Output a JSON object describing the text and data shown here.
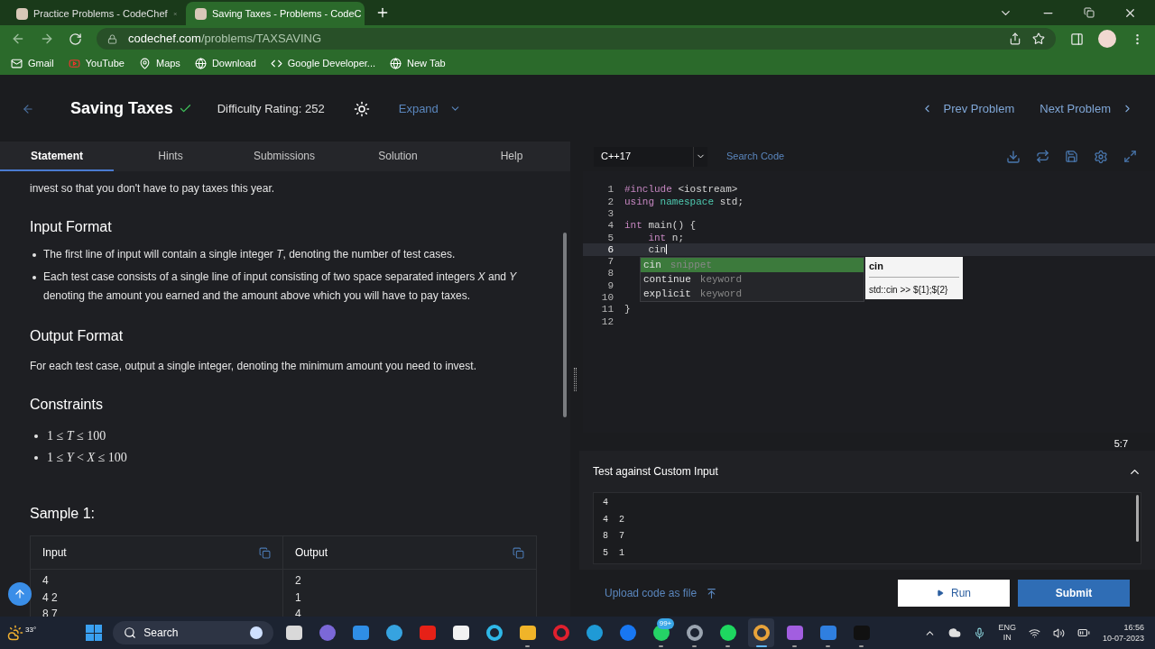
{
  "browser": {
    "tabs": [
      {
        "title": "Practice Problems - CodeChef",
        "selected": false
      },
      {
        "title": "Saving Taxes - Problems - CodeC",
        "selected": true
      }
    ],
    "url_host": "codechef.com",
    "url_path": "/problems/TAXSAVING",
    "bookmarks": [
      {
        "label": "Gmail",
        "kind": "mail"
      },
      {
        "label": "YouTube",
        "kind": "video"
      },
      {
        "label": "Maps",
        "kind": "pin"
      },
      {
        "label": "Download",
        "kind": "globe"
      },
      {
        "label": "Google Developer...",
        "kind": "code"
      },
      {
        "label": "New Tab",
        "kind": "globe"
      }
    ]
  },
  "problem": {
    "title": "Saving Taxes",
    "solved": true,
    "difficulty": "Difficulty Rating: 252",
    "expand": "Expand",
    "prev": "Prev Problem",
    "next": "Next Problem"
  },
  "statement_tabs": [
    {
      "label": "Statement",
      "selected": true
    },
    {
      "label": "Hints",
      "selected": false
    },
    {
      "label": "Submissions",
      "selected": false
    },
    {
      "label": "Solution",
      "selected": false
    },
    {
      "label": "Help",
      "selected": false
    }
  ],
  "statement": {
    "intro": "invest so that you don't have to pay taxes this year.",
    "sections": [
      {
        "kind": "bullets",
        "heading": "Input Format",
        "items": [
          "The first line of input will contain a single integer *T*, denoting the number of test cases.",
          "Each test case consists of a single line of input consisting of two space separated integers *X* and *Y* denoting the amount you earned and the amount above which you will have to pay taxes."
        ]
      },
      {
        "kind": "paragraph",
        "heading": "Output Format",
        "text": "For each test case, output a single integer, denoting the minimum amount you need to invest."
      },
      {
        "kind": "math",
        "heading": "Constraints",
        "items": [
          "1 ≤ *T* ≤ 100",
          "1 ≤ *Y* < *X* ≤ 100"
        ]
      }
    ]
  },
  "sample": {
    "heading": "Sample 1:",
    "input_label": "Input",
    "output_label": "Output",
    "input_lines": [
      "4",
      "4 2",
      "8 7"
    ],
    "output_lines": [
      "2",
      "1",
      "4"
    ]
  },
  "editor": {
    "language": "C++17",
    "search_placeholder": "Search Code",
    "cursor": "5:7",
    "lines": [
      {
        "number": "1",
        "active": false,
        "tokens": [
          {
            "text": "#include",
            "kind": "keyword"
          },
          {
            "text": " <iostream>",
            "kind": "plain"
          }
        ]
      },
      {
        "number": "2",
        "active": false,
        "tokens": [
          {
            "text": "using",
            "kind": "keyword"
          },
          {
            "text": " namespace",
            "kind": "namespace"
          },
          {
            "text": " std;",
            "kind": "plain"
          }
        ]
      },
      {
        "number": "3",
        "active": false
      },
      {
        "number": "4",
        "active": false,
        "tokens": [
          {
            "text": "int",
            "kind": "keyword"
          },
          {
            "text": " main() {",
            "kind": "plain"
          }
        ]
      },
      {
        "number": "5",
        "active": false,
        "tokens": [
          {
            "text": "    int",
            "kind": "keyword"
          },
          {
            "text": " n;",
            "kind": "plain"
          }
        ]
      },
      {
        "number": "6",
        "active": true,
        "tokens": [
          {
            "text": "    cin",
            "kind": "plain"
          }
        ]
      },
      {
        "number": "7",
        "active": false
      },
      {
        "number": "8",
        "active": false
      },
      {
        "number": "9",
        "active": false
      },
      {
        "number": "10",
        "active": false
      },
      {
        "number": "11",
        "active": false,
        "tokens": [
          {
            "text": "}",
            "kind": "plain"
          }
        ]
      },
      {
        "number": "12",
        "active": false
      }
    ],
    "suggestions": [
      {
        "label": "cin",
        "detail": "snippet",
        "selected": true
      },
      {
        "label": "continue",
        "detail": "keyword",
        "selected": false
      },
      {
        "label": "explicit",
        "detail": "keyword",
        "selected": false
      }
    ],
    "doc": {
      "title": "cin",
      "detail": "std::cin >> ${1};${2}"
    }
  },
  "custom_input": {
    "title": "Test against Custom Input",
    "expanded": true,
    "lines": [
      "4",
      "4  2",
      "8  7",
      "5  1"
    ]
  },
  "actions": {
    "upload": "Upload code as file",
    "run": "Run",
    "submit": "Submit"
  },
  "taskbar": {
    "weather": "33°",
    "search": "Search",
    "apps": [
      {
        "kind": "square",
        "color": "#d9d9d9",
        "running": false,
        "selected": false
      },
      {
        "kind": "circle",
        "color": "#7b68d8",
        "running": false,
        "selected": false
      },
      {
        "kind": "square",
        "color": "#2f8ee6",
        "running": false,
        "selected": false
      },
      {
        "kind": "circle",
        "color": "#36a3e0",
        "running": false,
        "selected": false
      },
      {
        "kind": "square",
        "color": "#e62117",
        "running": false,
        "selected": false
      },
      {
        "kind": "square",
        "color": "#f2f2f2",
        "running": false,
        "selected": false
      },
      {
        "kind": "ring",
        "color": "#2fb8e8",
        "running": false,
        "selected": false
      },
      {
        "kind": "square",
        "color": "#f0b429",
        "running": true,
        "selected": false
      },
      {
        "kind": "ring",
        "color": "#e0202e",
        "running": false,
        "selected": false
      },
      {
        "kind": "circle",
        "color": "#1f9ad6",
        "running": false,
        "selected": false
      },
      {
        "kind": "circle",
        "color": "#1877f2",
        "running": false,
        "selected": false
      },
      {
        "kind": "circle",
        "color": "#25d366",
        "running": true,
        "selected": false,
        "badge": "99+"
      },
      {
        "kind": "ring",
        "color": "#9aa4b0",
        "running": true,
        "selected": false
      },
      {
        "kind": "circle",
        "color": "#1ed760",
        "running": true,
        "selected": false
      },
      {
        "kind": "ring",
        "color": "#e8a33a",
        "running": true,
        "selected": true
      },
      {
        "kind": "square",
        "color": "#a25ee0",
        "running": true,
        "selected": false
      },
      {
        "kind": "square",
        "color": "#2f7fe0",
        "running": true,
        "selected": false
      },
      {
        "kind": "square",
        "color": "#111111",
        "running": true,
        "selected": false
      }
    ],
    "language": "ENG",
    "region": "IN",
    "time": "16:56",
    "date": "10-07-2023"
  }
}
